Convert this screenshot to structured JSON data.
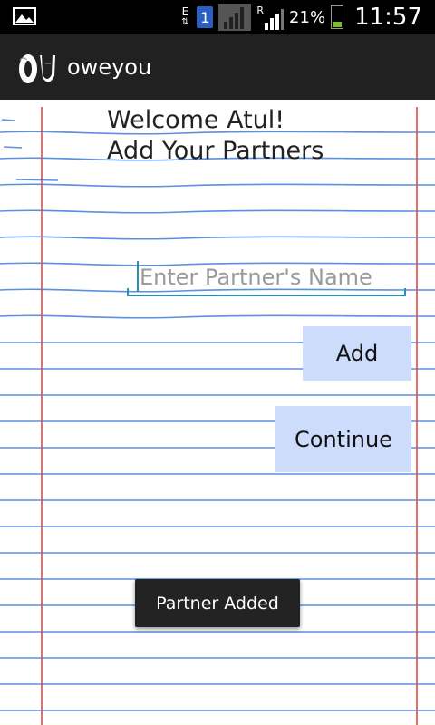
{
  "status_bar": {
    "network_type": "E",
    "sim_slot": "1",
    "roaming": "R",
    "battery": "21%",
    "time": "11:57"
  },
  "app": {
    "title": "oweyou",
    "logo_text": "OU"
  },
  "main": {
    "welcome_line1": "Welcome Atul!",
    "welcome_line2": "Add Your Partners",
    "partner_input_placeholder": "Enter Partner's Name",
    "partner_input_value": "",
    "add_label": "Add",
    "continue_label": "Continue"
  },
  "toast": {
    "message": "Partner Added"
  },
  "colors": {
    "notebook_line": "#5b8fe0",
    "margin_line": "#e04a4a",
    "button_bg": "#cddcfb",
    "accent": "#2a8fb8"
  }
}
